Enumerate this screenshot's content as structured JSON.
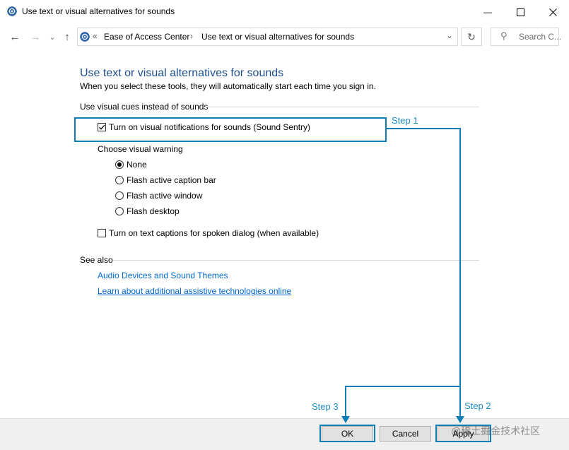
{
  "window": {
    "title": "Use text or visual alternatives for sounds"
  },
  "titlebar": {
    "minimize_glyph": "—",
    "maximize_glyph": "☐",
    "close_glyph": "✕"
  },
  "nav": {
    "back_glyph": "←",
    "forward_glyph": "→",
    "recent_glyph": "⌄",
    "up_glyph": "↑",
    "breadcrumb_prefix": "«",
    "breadcrumb": [
      "Ease of Access Center",
      "Use text or visual alternatives for sounds"
    ],
    "breadcrumb_sep": "›",
    "dropdown_glyph": "⌄",
    "refresh_glyph": "↻",
    "search_placeholder": "Search C...",
    "search_glyph": "⚲"
  },
  "main": {
    "title": "Use text or visual alternatives for sounds",
    "subtitle": "When you select these tools, they will automatically start each time you sign in.",
    "visual_cues": {
      "section_label": "Use visual cues instead of sounds",
      "sound_sentry_label": "Turn on visual notifications for sounds (Sound Sentry)",
      "sound_sentry_checked": true,
      "warning_label": "Choose visual warning",
      "options": [
        {
          "label": "None",
          "selected": true
        },
        {
          "label": "Flash active caption bar",
          "selected": false
        },
        {
          "label": "Flash active window",
          "selected": false
        },
        {
          "label": "Flash desktop",
          "selected": false
        }
      ],
      "captions_label": "Turn on text captions for spoken dialog (when available)",
      "captions_checked": false
    },
    "see_also": {
      "label": "See also",
      "links": [
        "Audio Devices and Sound Themes",
        "Learn about additional assistive technologies online"
      ]
    }
  },
  "footer": {
    "ok": "OK",
    "cancel": "Cancel",
    "apply": "Apply"
  },
  "annotations": {
    "step1": "Step 1",
    "step2": "Step 2",
    "step3": "Step 3",
    "accent_color": "#0c7fb8"
  },
  "watermark": "@稀土掘金技术社区",
  "colors": {
    "heading": "#1e4e8c",
    "link": "#0066cc"
  }
}
